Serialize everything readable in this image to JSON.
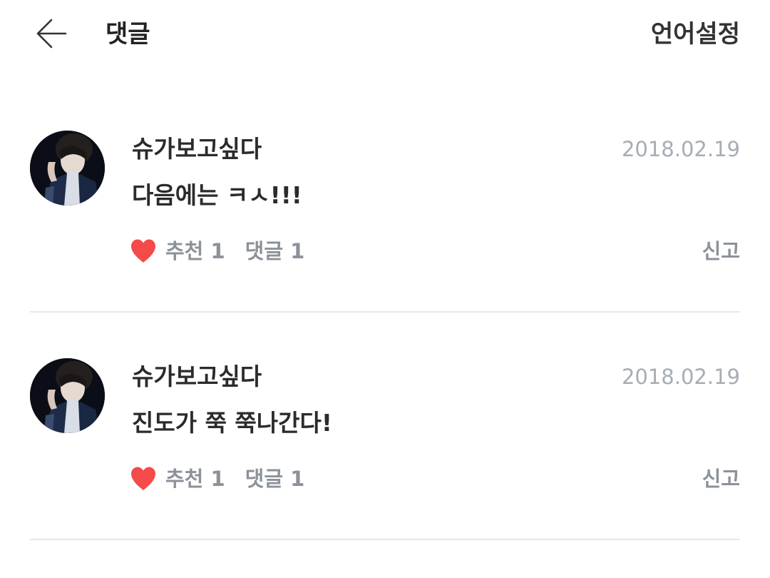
{
  "header": {
    "back_icon": "arrow-left-icon",
    "title": "댓글",
    "language_label": "언어설정"
  },
  "colors": {
    "heart": "#f44a4a",
    "meta_gray": "#a6adb5",
    "action_gray": "#8c929a",
    "divider": "#e8e8e8"
  },
  "comments": [
    {
      "author": "슈가보고싶다",
      "date": "2018.02.19",
      "text": "다음에는 ㅋㅅ!!!",
      "like_icon": "heart-icon",
      "like_label": "추천 1",
      "reply_label": "댓글 1",
      "report_label": "신고"
    },
    {
      "author": "슈가보고싶다",
      "date": "2018.02.19",
      "text": "진도가 쭉 쭉나간다!",
      "like_icon": "heart-icon",
      "like_label": "추천 1",
      "reply_label": "댓글 1",
      "report_label": "신고"
    }
  ]
}
